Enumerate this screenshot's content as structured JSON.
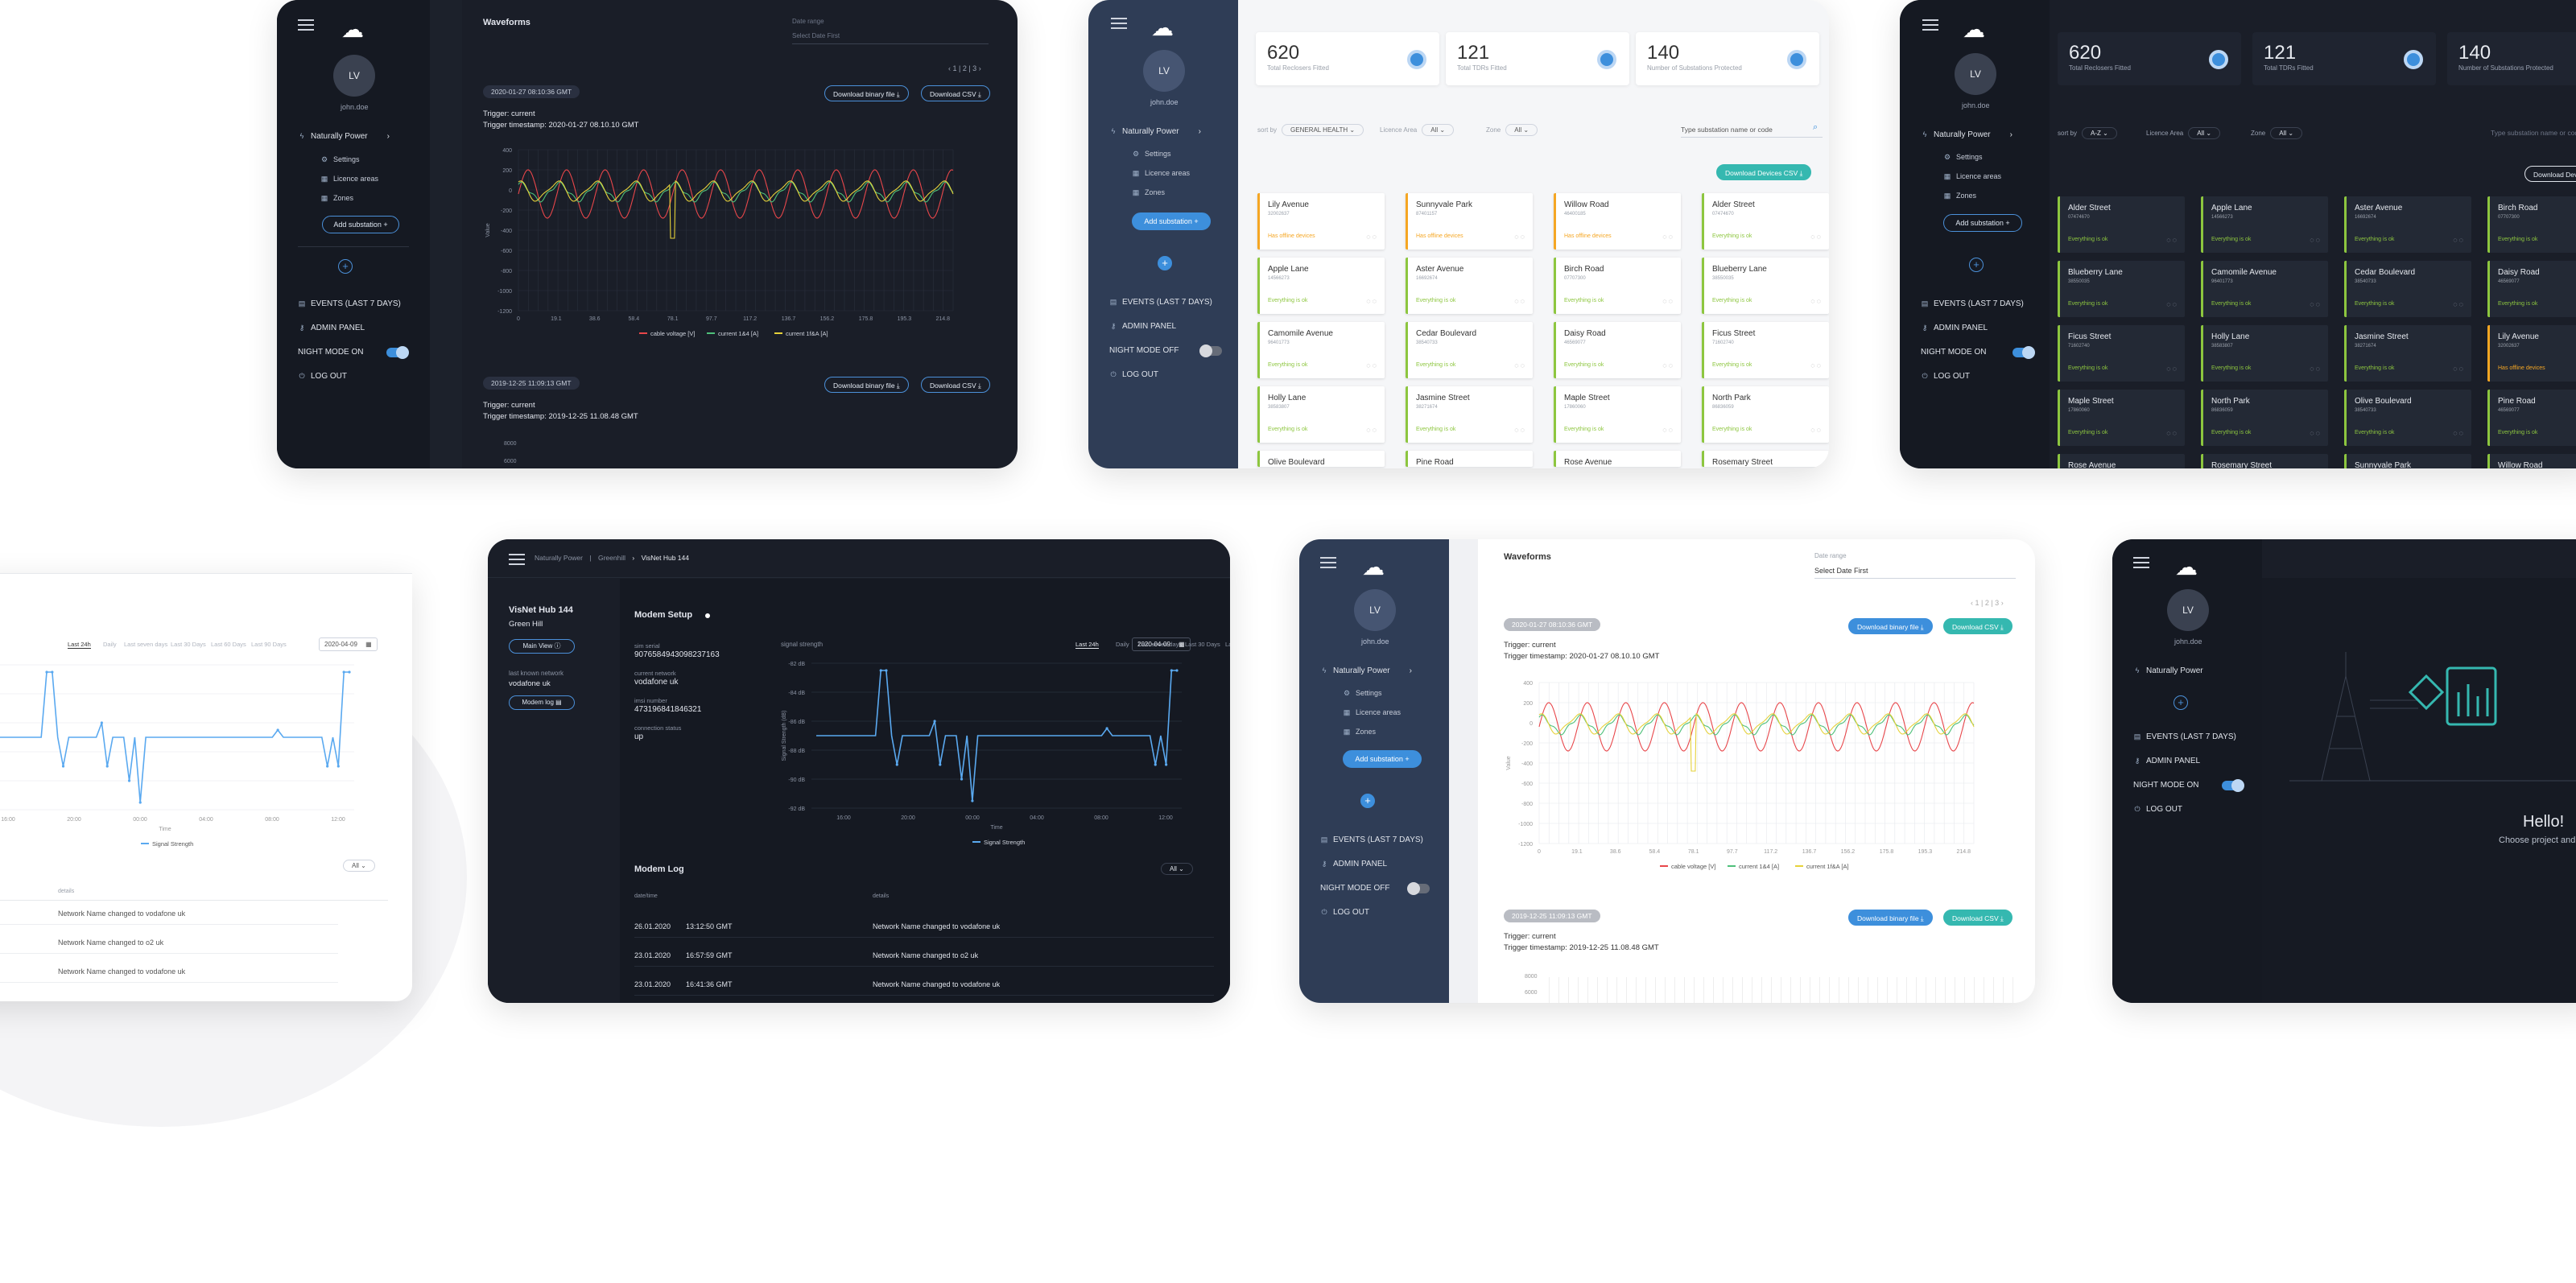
{
  "common": {
    "avatar_initials": "LV",
    "username": "john.doe",
    "company": "Naturally Power",
    "settings": "Settings",
    "licence_areas": "Licence areas",
    "zones": "Zones",
    "add_substation": "Add substation",
    "events": "EVENTS (LAST 7 DAYS)",
    "admin_panel": "ADMIN PANEL",
    "night_on": "NIGHT MODE ON",
    "night_off": "NIGHT MODE OFF",
    "logout": "LOG OUT"
  },
  "waveforms": {
    "title": "Waveforms",
    "date_range_label": "Date range",
    "date_range_placeholder": "Select Date First",
    "pager": [
      "1",
      "2",
      "3"
    ],
    "event1_tag": "2020-01-27 08:10:36 GMT",
    "event1_trigger": "Trigger: current",
    "event1_timestamp": "Trigger timestamp: 2020-01-27 08.10.10 GMT",
    "event2_tag": "2019-12-25 11:09:13 GMT",
    "event2_trigger": "Trigger: current",
    "event2_timestamp": "Trigger timestamp: 2019-12-25 11.08.48 GMT",
    "download_binary": "Download binary file",
    "download_csv": "Download CSV",
    "ylabel": "Value",
    "legend": [
      "cable voltage [V]",
      "current 1&4 [A]",
      "current 1f&A [A]"
    ],
    "second_chart_top": "8000",
    "second_chart_top2": "6000"
  },
  "dashboard": {
    "stats": [
      {
        "value": "620",
        "label": "Total Reclosers Fitted"
      },
      {
        "value": "121",
        "label": "Total TDRs Fitted"
      },
      {
        "value": "140",
        "label": "Number of Substations Protected"
      }
    ],
    "sort_by_label": "sort by",
    "sort_light": "GENERAL HEALTH",
    "sort_dark": "A-Z",
    "licence_label": "Licence Area",
    "licence_value": "All",
    "zone_label": "Zone",
    "zone_value": "All",
    "search_placeholder": "Type substation name or code",
    "download_devices": "Download Devices CSV",
    "status_ok": "Everything is ok",
    "status_warn": "Has offline devices"
  },
  "substations_light": [
    {
      "name": "Lily Avenue",
      "code": "32002637",
      "status": "warn"
    },
    {
      "name": "Sunnyvale Park",
      "code": "87401157",
      "status": "warn"
    },
    {
      "name": "Willow Road",
      "code": "46400185",
      "status": "warn"
    },
    {
      "name": "Alder Street",
      "code": "07474670",
      "status": "ok"
    },
    {
      "name": "Apple Lane",
      "code": "14566273",
      "status": "ok"
    },
    {
      "name": "Aster Avenue",
      "code": "16692674",
      "status": "ok"
    },
    {
      "name": "Birch Road",
      "code": "07707300",
      "status": "ok"
    },
    {
      "name": "Blueberry Lane",
      "code": "38550035",
      "status": "ok"
    },
    {
      "name": "Camomile Avenue",
      "code": "96401773",
      "status": "ok"
    },
    {
      "name": "Cedar Boulevard",
      "code": "38540733",
      "status": "ok"
    },
    {
      "name": "Daisy Road",
      "code": "46569077",
      "status": "ok"
    },
    {
      "name": "Ficus Street",
      "code": "71602740",
      "status": "ok"
    },
    {
      "name": "Holly Lane",
      "code": "38583807",
      "status": "ok"
    },
    {
      "name": "Jasmine Street",
      "code": "38271674",
      "status": "ok"
    },
    {
      "name": "Maple Street",
      "code": "17860060",
      "status": "ok"
    },
    {
      "name": "North Park",
      "code": "86836059",
      "status": "ok"
    }
  ],
  "substations_light_partial": [
    "Olive Boulevard",
    "Pine Road",
    "Rose Avenue",
    "Rosemary Street"
  ],
  "substations_dark": [
    {
      "name": "Alder Street",
      "code": "07474670",
      "status": "ok"
    },
    {
      "name": "Apple Lane",
      "code": "14566273",
      "status": "ok"
    },
    {
      "name": "Aster Avenue",
      "code": "16692674",
      "status": "ok"
    },
    {
      "name": "Birch Road",
      "code": "07707300",
      "status": "ok"
    },
    {
      "name": "Blueberry Lane",
      "code": "38550035",
      "status": "ok"
    },
    {
      "name": "Camomile Avenue",
      "code": "96401773",
      "status": "ok"
    },
    {
      "name": "Cedar Boulevard",
      "code": "38540733",
      "status": "ok"
    },
    {
      "name": "Daisy Road",
      "code": "46569077",
      "status": "ok"
    },
    {
      "name": "Ficus Street",
      "code": "71602740",
      "status": "ok"
    },
    {
      "name": "Holly Lane",
      "code": "38583807",
      "status": "ok"
    },
    {
      "name": "Jasmine Street",
      "code": "38271674",
      "status": "ok"
    },
    {
      "name": "Lily Avenue",
      "code": "32002637",
      "status": "warn"
    },
    {
      "name": "Maple Street",
      "code": "17860060",
      "status": "ok"
    },
    {
      "name": "North Park",
      "code": "86836059",
      "status": "ok"
    },
    {
      "name": "Olive Boulevard",
      "code": "38540733",
      "status": "ok"
    },
    {
      "name": "Pine Road",
      "code": "46569077",
      "status": "ok"
    }
  ],
  "substations_dark_partial": [
    "Rose Avenue",
    "Rosemary Street",
    "Sunnyvale Park",
    "Willow Road"
  ],
  "visnet": {
    "breadcrumb": [
      "Naturally Power",
      "Greenhill",
      "VisNet Hub 144"
    ],
    "hub_name": "VisNet Hub 144",
    "hub_location": "Green Hill",
    "main_view": "Main View",
    "modem_log_btn": "Modem log",
    "last_known_label": "last known network",
    "last_known_value": "vodafone uk",
    "modem_setup": "Modem Setup",
    "sim_serial_label": "sim serial",
    "sim_serial": "9076584943098237163",
    "network_label": "current network",
    "network": "vodafone uk",
    "imsi_label": "imsi number",
    "imsi": "473196841846321",
    "connection_label": "connection status",
    "connection": "up",
    "signal_label": "signal strength",
    "ranges": [
      "Last 24h",
      "Daily",
      "Last seven days",
      "Last 30 Days",
      "Last 60 Days",
      "Last 90 Days"
    ],
    "date": "2020-04-09",
    "ylabel": "Signal Strength (dB)",
    "xlabel": "Time",
    "legend": "Signal Strength",
    "modem_log": "Modem Log",
    "filter_all": "All",
    "col_date": "date/time",
    "col_details": "details",
    "log": [
      {
        "date": "26.01.2020",
        "time": "13:12:50 GMT",
        "details": "Network Name changed to vodafone uk"
      },
      {
        "date": "23.01.2020",
        "time": "16:57:59 GMT",
        "details": "Network Name changed to o2 uk"
      },
      {
        "date": "23.01.2020",
        "time": "16:41:36 GMT",
        "details": "Network Name changed to vodafone uk"
      }
    ]
  },
  "welcome": {
    "hello": "Hello!",
    "choose": "Choose project and"
  },
  "chart_data": [
    {
      "type": "line",
      "title": "Waveforms",
      "ylabel": "Value",
      "x": [
        0,
        19.1,
        38.6,
        58.4,
        78.1,
        97.7,
        117.2,
        136.7,
        156.2,
        175.8,
        195.3,
        214.8
      ],
      "ylim": [
        -1200,
        400
      ],
      "yticks": [
        400,
        200,
        0,
        -200,
        -400,
        -600,
        -800,
        -1000,
        -1200
      ],
      "series": [
        {
          "name": "cable voltage [V]",
          "color": "#e8464a",
          "amplitude": 240,
          "period": 19.5,
          "offset": -40
        },
        {
          "name": "current 1&4 [A]",
          "color": "#4ec07a",
          "amplitude": 80,
          "period": 19.5,
          "offset": -20
        },
        {
          "name": "current 1f&A [A]",
          "color": "#e6d23a",
          "amplitude": 90,
          "period": 19.5,
          "offset": -10,
          "spike_at": 78.1,
          "spike_value": -480
        }
      ]
    },
    {
      "type": "line",
      "title": "Signal Strength",
      "xlabel": "Time",
      "ylabel": "Signal Strength (dB)",
      "x": [
        "16:00",
        "20:00",
        "00:00",
        "04:00",
        "08:00",
        "12:00"
      ],
      "yticks": [
        "-82 dB",
        "-84 dB",
        "-86 dB",
        "-88 dB",
        "-90 dB",
        "-92 dB"
      ],
      "ylim": [
        -92,
        -82
      ],
      "series": [
        {
          "name": "Signal Strength",
          "color": "#5aa9f0",
          "values": [
            -87,
            -87,
            -87,
            -87,
            -87,
            -87,
            -87,
            -87,
            -87,
            -87,
            -87,
            -87,
            -82.5,
            -82.5,
            -87,
            -89,
            -87,
            -87,
            -87,
            -87,
            -87,
            -87,
            -86,
            -89,
            -87,
            -87,
            -87,
            -90,
            -87,
            -91.5,
            -87,
            -87,
            -87,
            -87,
            -87,
            -87,
            -87,
            -87,
            -87,
            -87,
            -87,
            -87,
            -87,
            -87,
            -87,
            -87,
            -87,
            -87,
            -87,
            -87,
            -87,
            -87,
            -87,
            -87,
            -86.5,
            -87,
            -87,
            -87,
            -87,
            -87,
            -87,
            -87,
            -87,
            -89,
            -87,
            -89,
            -82.5,
            -82.5
          ]
        }
      ]
    }
  ]
}
